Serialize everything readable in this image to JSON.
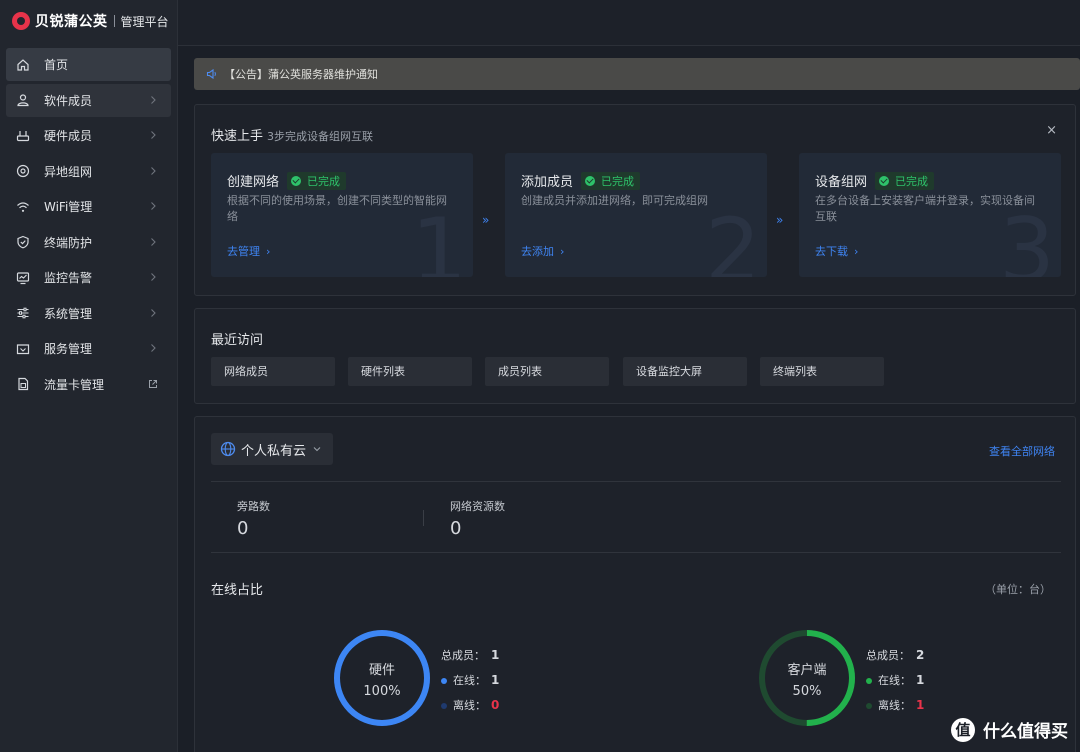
{
  "brand": {
    "name": "贝锐蒲公英",
    "subtitle": "管理平台"
  },
  "sidebar": {
    "items": [
      {
        "label": "首页",
        "icon": "home-icon"
      },
      {
        "label": "软件成员",
        "icon": "user-icon"
      },
      {
        "label": "硬件成员",
        "icon": "router-icon"
      },
      {
        "label": "异地组网",
        "icon": "network-icon"
      },
      {
        "label": "WiFi管理",
        "icon": "wifi-icon"
      },
      {
        "label": "终端防护",
        "icon": "shield-icon"
      },
      {
        "label": "监控告警",
        "icon": "monitor-icon"
      },
      {
        "label": "系统管理",
        "icon": "sliders-icon"
      },
      {
        "label": "服务管理",
        "icon": "service-icon"
      },
      {
        "label": "流量卡管理",
        "icon": "sim-card-icon"
      }
    ]
  },
  "notice": {
    "text": "【公告】蒲公英服务器维护通知"
  },
  "quickstart": {
    "title": "快速上手",
    "subtitle": "3步完成设备组网互联",
    "close": "×",
    "steps": [
      {
        "title": "创建网络",
        "status": "已完成",
        "desc": "根据不同的使用场景，创建不同类型的智能网络",
        "link": "去管理",
        "num": "1"
      },
      {
        "title": "添加成员",
        "status": "已完成",
        "desc": "创建成员并添加进网络，即可完成组网",
        "link": "去添加",
        "num": "2"
      },
      {
        "title": "设备组网",
        "status": "已完成",
        "desc": "在多台设备上安装客户端并登录，实现设备间互联",
        "link": "去下载",
        "num": "3"
      }
    ],
    "separator": "»"
  },
  "recent": {
    "title": "最近访问",
    "items": [
      "网络成员",
      "硬件列表",
      "成员列表",
      "设备监控大屏",
      "终端列表"
    ]
  },
  "network": {
    "selected": "个人私有云",
    "view_all": "查看全部网络",
    "stats": [
      {
        "label": "旁路数",
        "value": "0"
      },
      {
        "label": "网络资源数",
        "value": "0"
      }
    ],
    "ratio_title": "在线占比",
    "unit": "（单位：台）",
    "colors": {
      "hardware": "#3d86f4",
      "client": "#22b14c",
      "client_track": "#1f4a30",
      "offline_hw": "#1f3a6e",
      "offline_client": "#1f4a30"
    },
    "donuts": [
      {
        "name": "硬件",
        "pct_label": "100%",
        "online_fraction": 1.0,
        "total_label": "总成员：",
        "total": "1",
        "online_label": "在线：",
        "online": "1",
        "offline_label": "离线：",
        "offline": "0"
      },
      {
        "name": "客户端",
        "pct_label": "50%",
        "online_fraction": 0.5,
        "total_label": "总成员：",
        "total": "2",
        "online_label": "在线：",
        "online": "1",
        "offline_label": "离线：",
        "offline": "1"
      }
    ]
  },
  "watermark": {
    "glyph": "值",
    "text": "什么值得买"
  }
}
